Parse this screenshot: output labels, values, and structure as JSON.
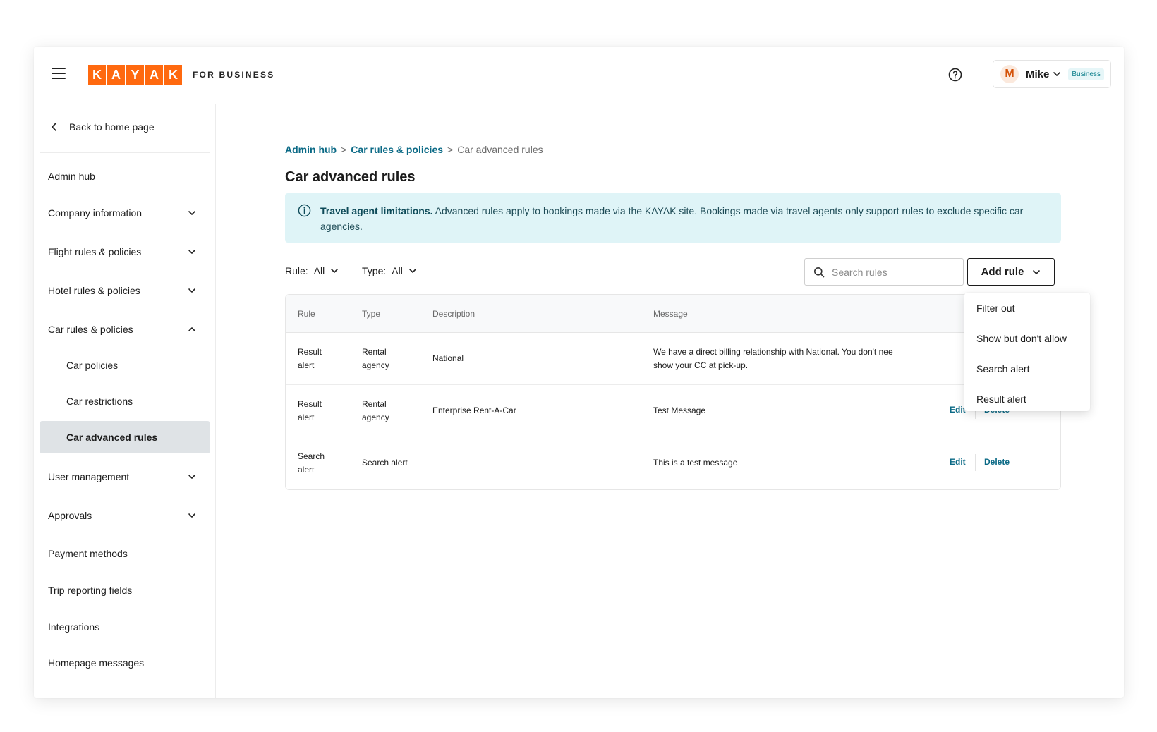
{
  "header": {
    "logo_letters": [
      "K",
      "A",
      "Y",
      "A",
      "K"
    ],
    "logo_suffix": "FOR BUSINESS",
    "user": {
      "initial": "M",
      "name": "Mike",
      "badge": "Business"
    }
  },
  "sidebar": {
    "back_label": "Back to home page",
    "items": [
      {
        "label": "Admin hub"
      },
      {
        "label": "Company information"
      },
      {
        "label": "Flight rules & policies"
      },
      {
        "label": "Hotel rules & policies"
      },
      {
        "label": "Car rules & policies"
      },
      {
        "label": "Car policies"
      },
      {
        "label": "Car restrictions"
      },
      {
        "label": "Car advanced rules"
      },
      {
        "label": "User management"
      },
      {
        "label": "Approvals"
      },
      {
        "label": "Payment methods"
      },
      {
        "label": "Trip reporting fields"
      },
      {
        "label": "Integrations"
      },
      {
        "label": "Homepage messages"
      }
    ]
  },
  "breadcrumb": {
    "items": [
      "Admin hub",
      "Car rules & policies",
      "Car advanced rules"
    ],
    "separator": ">"
  },
  "page_title": "Car advanced rules",
  "banner": {
    "title": "Travel agent limitations.",
    "text": "Advanced rules apply to bookings made via the KAYAK site. Bookings made via travel agents only support rules to exclude specific car agencies."
  },
  "filters": {
    "rule_label": "Rule:",
    "rule_value": "All",
    "type_label": "Type:",
    "type_value": "All"
  },
  "search": {
    "placeholder": "Search rules"
  },
  "add_rule": {
    "label": "Add rule"
  },
  "table": {
    "columns": [
      "Rule",
      "Type",
      "Description",
      "Message"
    ],
    "rows": [
      {
        "rule": [
          "Result",
          "alert"
        ],
        "type": [
          "Rental",
          "agency"
        ],
        "description": "National",
        "message": [
          "We have a direct billing relationship with National. You don't nee",
          "show your CC at pick-up."
        ]
      },
      {
        "rule": [
          "Result",
          "alert"
        ],
        "type": [
          "Rental",
          "agency"
        ],
        "description": "Enterprise Rent-A-Car",
        "message": [
          "Test Message"
        ],
        "edit": "Edit",
        "delete": "Delete"
      },
      {
        "rule": [
          "Search",
          "alert"
        ],
        "type": [
          "Search alert"
        ],
        "description": "",
        "message": [
          "This is a test message"
        ],
        "edit": "Edit",
        "delete": "Delete"
      }
    ]
  },
  "add_rule_menu": {
    "options": [
      "Filter out",
      "Show but don't allow",
      "Search alert",
      "Result alert"
    ]
  },
  "colors": {
    "brand": "#ff690f",
    "link": "#0b6a86",
    "banner_bg": "#dff4f7",
    "active_nav": "#dfe3e6"
  }
}
